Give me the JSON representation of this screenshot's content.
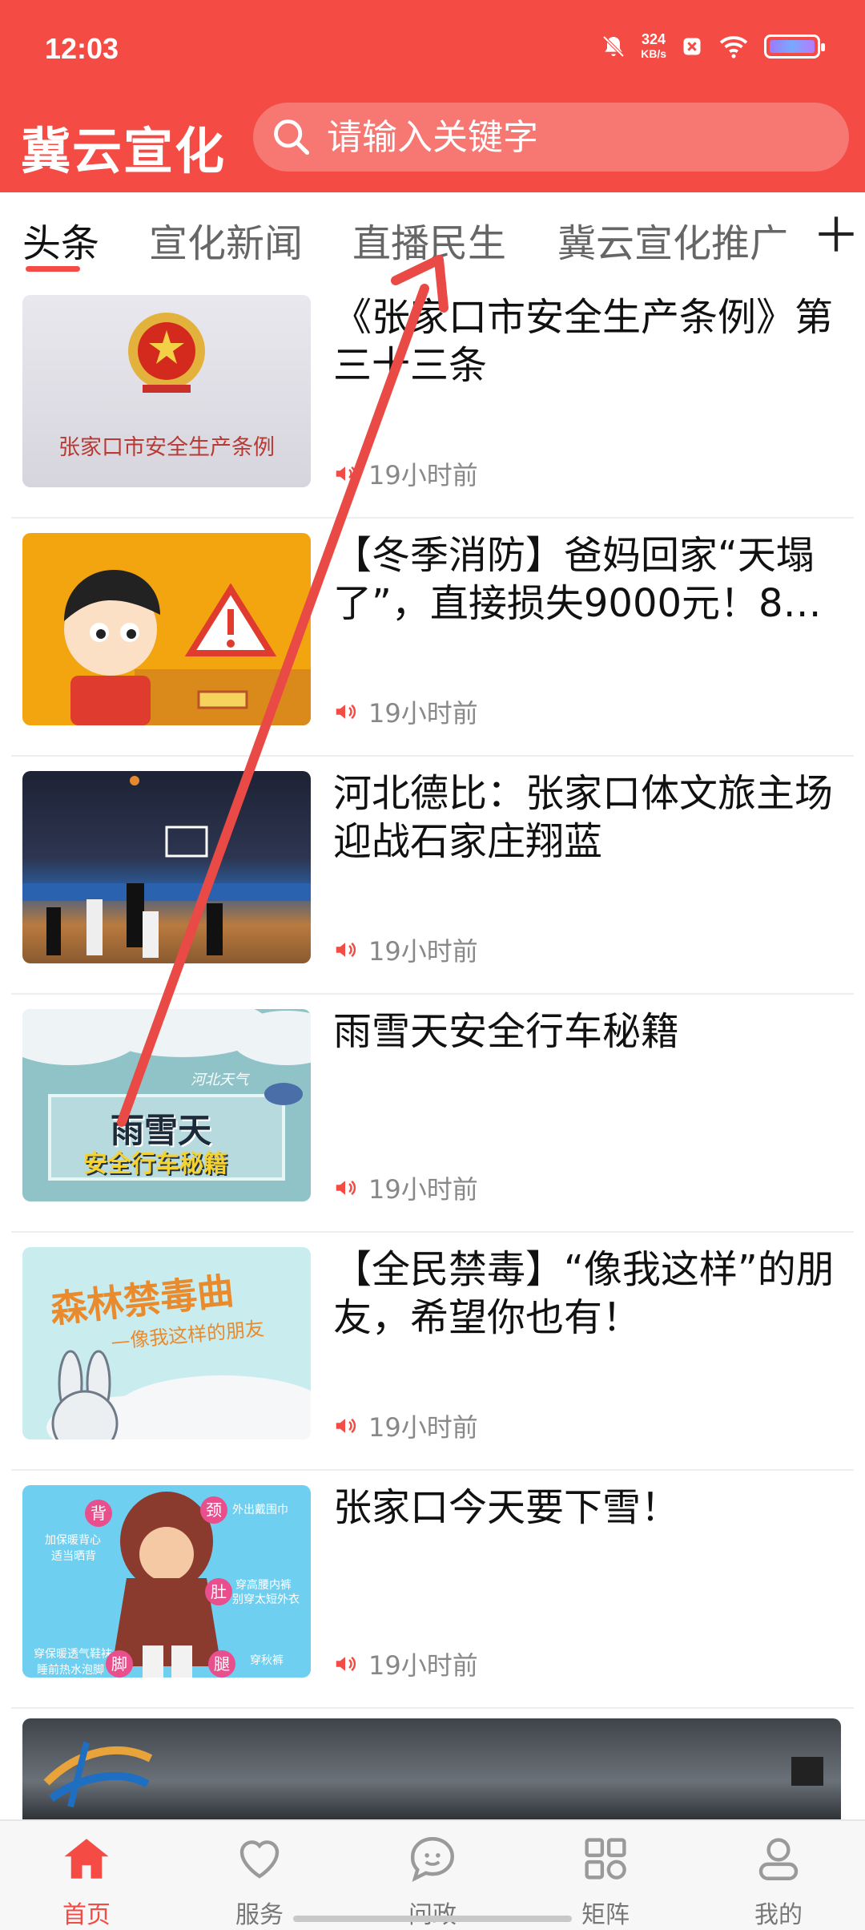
{
  "status_bar": {
    "time": "12:03",
    "net_speed": "324",
    "net_unit": "KB/s"
  },
  "app": {
    "logo": "冀云宣化",
    "search_placeholder": "请输入关键字"
  },
  "tabs": [
    {
      "label": "头条",
      "active": true
    },
    {
      "label": "宣化新闻"
    },
    {
      "label": "直播民生"
    },
    {
      "label": "冀云宣化推广"
    }
  ],
  "feed": [
    {
      "title": "《张家口市安全生产条例》第三十三条",
      "time": "19小时前",
      "thumb_caption": "张家口市安全生产条例"
    },
    {
      "title": "【冬季消防】爸妈回家“天塌了”，直接损失9000元！8…",
      "time": "19小时前"
    },
    {
      "title": "河北德比：张家口体文旅主场迎战石家庄翔蓝",
      "time": "19小时前"
    },
    {
      "title": "雨雪天安全行车秘籍",
      "time": "19小时前",
      "thumb_caption_top": "河北天气",
      "thumb_caption_1": "雨雪天",
      "thumb_caption_2": "安全行车秘籍"
    },
    {
      "title": "【全民禁毒】“像我这样”的朋友，希望你也有！",
      "time": "19小时前",
      "thumb_caption_1": "森林禁毒曲",
      "thumb_caption_2": "—像我这样的朋友"
    },
    {
      "title": "张家口今天要下雪！",
      "time": "19小时前",
      "thumb_labels": [
        "背",
        "颈",
        "加保暖背心",
        "适当晒背",
        "外出戴围巾",
        "肚",
        "穿高腰内裤",
        "别穿太短外衣",
        "穿保暖透气鞋袜",
        "腿",
        "脚",
        "睡前热水泡脚",
        "穿秋裤"
      ]
    }
  ],
  "bottom_nav": [
    {
      "label": "首页",
      "active": true,
      "icon": "home-icon"
    },
    {
      "label": "服务",
      "icon": "heart-icon"
    },
    {
      "label": "问政",
      "icon": "chat-bubble-icon"
    },
    {
      "label": "矩阵",
      "icon": "grid-icon"
    },
    {
      "label": "我的",
      "icon": "user-icon"
    }
  ],
  "colors": {
    "brand": "#f44b44",
    "annotation_arrow": "#ea4a45"
  }
}
